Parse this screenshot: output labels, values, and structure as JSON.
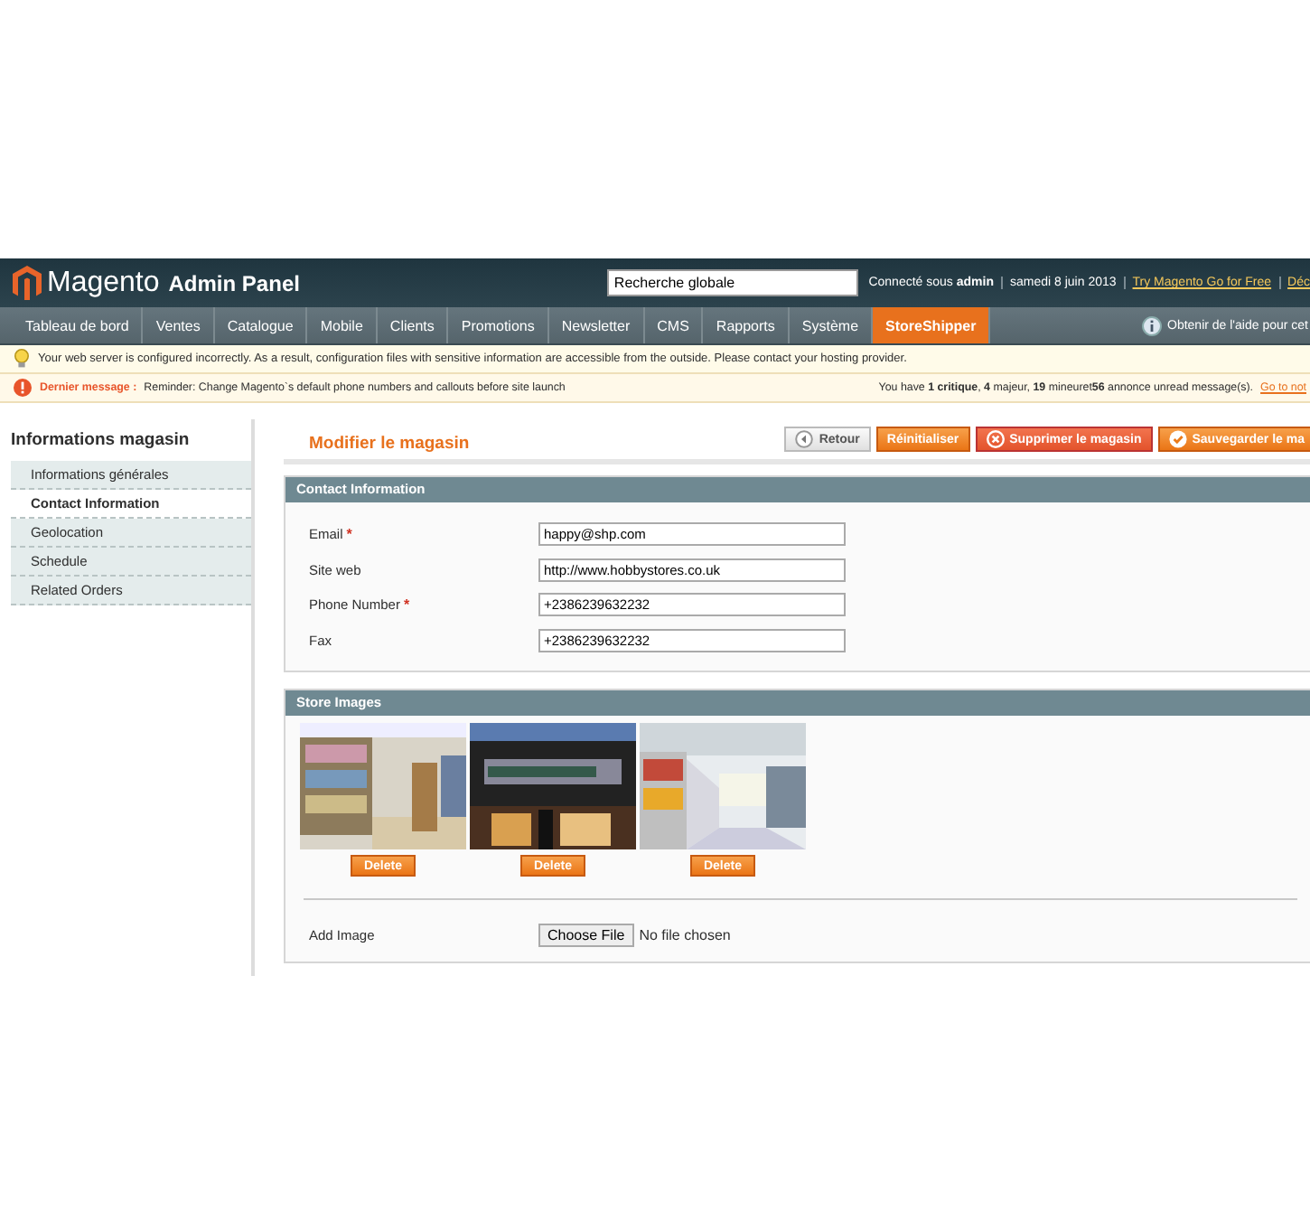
{
  "header": {
    "logo": "Magento",
    "subtitle": "Admin Panel",
    "search": {
      "value": "Recherche globale"
    },
    "user_text": "Connecté sous **admin**",
    "date": "samedi 8 juin 2013",
    "links": [
      "Try Magento Go for Free",
      "Déc"
    ]
  },
  "nav": {
    "items": [
      {
        "label": "Tableau de bord",
        "selected": false
      },
      {
        "label": "Ventes",
        "selected": false
      },
      {
        "label": "Catalogue",
        "selected": false
      },
      {
        "label": "Mobile",
        "selected": false
      },
      {
        "label": "Clients",
        "selected": false
      },
      {
        "label": "Promotions",
        "selected": false
      },
      {
        "label": "Newsletter",
        "selected": false
      },
      {
        "label": "CMS",
        "selected": false
      },
      {
        "label": "Rapports",
        "selected": false
      },
      {
        "label": "Système",
        "selected": false
      },
      {
        "label": "StoreShipper",
        "selected": true
      }
    ],
    "help": "Obtenir de l'aide pour cet"
  },
  "notices": {
    "warning": "Your web server is configured incorrectly. As a result, configuration files with sensitive information are accessible from the outside. Please contact your hosting provider.",
    "latest_label": "Dernier message :",
    "latest_text": "Reminder: Change Magento`s default phone numbers and callouts before site launch",
    "summary": "You have **1 critique**, **4** majeur, **19** mineuret**56** annonce unread message(s).",
    "summary_link": "Go to not"
  },
  "sidebar": {
    "title": "Informations magasin",
    "items": [
      {
        "label": "Informations générales",
        "selected": false
      },
      {
        "label": "Contact Information",
        "selected": true
      },
      {
        "label": "Geolocation",
        "selected": false
      },
      {
        "label": "Schedule",
        "selected": false
      },
      {
        "label": "Related Orders",
        "selected": false
      }
    ]
  },
  "page_title": "Modifier le magasin",
  "buttons": [
    {
      "label": "Retour",
      "kind": "back"
    },
    {
      "label": "Réinitialiser",
      "kind": "plain"
    },
    {
      "label": "Supprimer le magasin",
      "kind": "delete"
    },
    {
      "label": "Sauvegarder le ma",
      "kind": "save"
    }
  ],
  "contact": {
    "title": "Contact Information",
    "required_mark": "*",
    "fields": [
      {
        "label": "Email",
        "required": true,
        "value": "happy@shp.com"
      },
      {
        "label": "Site web",
        "required": false,
        "value": "http://www.hobbystores.co.uk"
      },
      {
        "label": "Phone Number",
        "required": true,
        "value": "+2386239632232"
      },
      {
        "label": "Fax",
        "required": false,
        "value": "+2386239632232"
      }
    ]
  },
  "images": {
    "title": "Store Images",
    "items": [
      {
        "kind": "picture",
        "button": "Delete"
      },
      {
        "kind": "picture",
        "button": "Delete"
      },
      {
        "kind": "picture",
        "button": "Delete"
      }
    ],
    "add_label": "Add Image",
    "file_button": "Choose File",
    "file_status": "No file chosen"
  }
}
